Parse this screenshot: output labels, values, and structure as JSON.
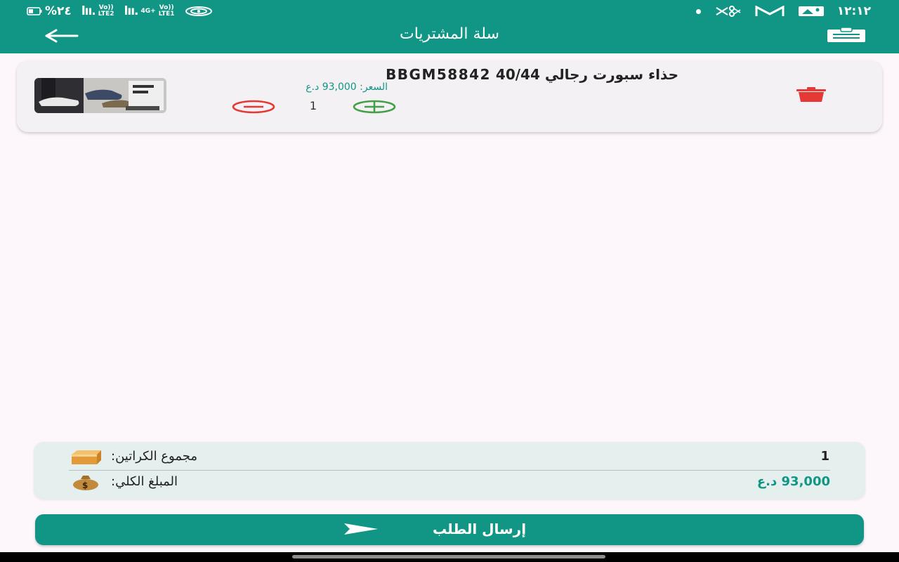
{
  "status_bar": {
    "battery": "%٢٤",
    "lte2": "LTE2",
    "lte1": "LTE1",
    "signal_4g": "4G+",
    "volte": "Vo))",
    "time": "١٢:١٢",
    "icons": [
      "battery-icon",
      "signal-icon",
      "wifi-icon",
      "dot-icon",
      "scissors-icon",
      "gmail-icon",
      "gallery-icon"
    ]
  },
  "header": {
    "title": "سلة المشتريات",
    "back_icon": "arrow-left-icon",
    "action_icon": "clipboard-icon"
  },
  "cart": {
    "items": [
      {
        "name": "حذاء سبورت رجالي 40/44 BBGM58842",
        "price": "السعر: 93,000 د.ع",
        "quantity": "1",
        "thumbnail": "shoe-product-image"
      }
    ]
  },
  "summary": {
    "boxes_label": "مجموع الكراتين:",
    "boxes_value": "1",
    "total_label": "المبلغ الكلي:",
    "total_value": "93,000 د.ع",
    "boxes_icon": "box-icon",
    "total_icon": "money-bag-icon"
  },
  "actions": {
    "submit_label": "إرسال الطلب",
    "submit_icon": "send-icon"
  },
  "colors": {
    "primary": "#119686",
    "danger": "#e53935",
    "success": "#43a047",
    "background": "#fdf6fb"
  }
}
